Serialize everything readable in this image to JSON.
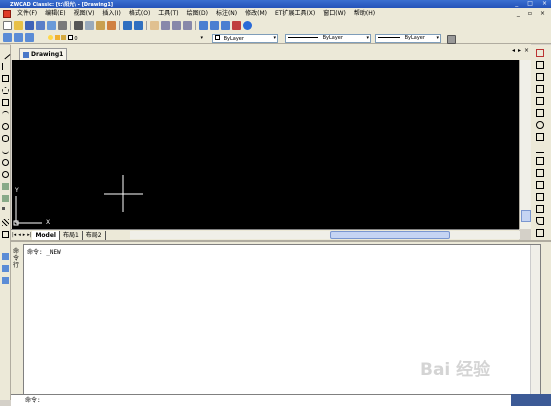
{
  "window": {
    "title": "ZWCAD Classic: [t:\\阳光\\ - [Drawing1]",
    "controls": [
      "_",
      "□",
      "×"
    ]
  },
  "menu": {
    "items": [
      "文件(F)",
      "编辑(E)",
      "视图(V)",
      "插入(I)",
      "格式(O)",
      "工具(T)",
      "绘图(D)",
      "标注(N)",
      "修改(M)",
      "ET扩展工具(X)",
      "窗口(W)",
      "帮助(H)"
    ],
    "mdi_controls": [
      "_",
      "▫",
      "×"
    ]
  },
  "properties": {
    "layer": "0",
    "color": "ByLayer",
    "linetype": "ByLayer",
    "lineweight": "ByLayer"
  },
  "document": {
    "tab_title": "Drawing1",
    "tab_controls": [
      "◂",
      "▸",
      "×"
    ]
  },
  "ucs": {
    "x_label": "X",
    "y_label": "Y"
  },
  "layout_tabs": {
    "nav": [
      "|◂",
      "◂",
      "▸",
      "▸|"
    ],
    "tabs": [
      "Model",
      "布局1",
      "布局2"
    ]
  },
  "command": {
    "history_lines": [
      "命令: _NEW"
    ],
    "side_label": "命令行",
    "prompt": "命令:"
  },
  "watermark": "Bai 经验",
  "colors": {
    "canvas": "#000000",
    "title_bar": "#2452b8",
    "toolbar_bg": "#ece9d8"
  }
}
